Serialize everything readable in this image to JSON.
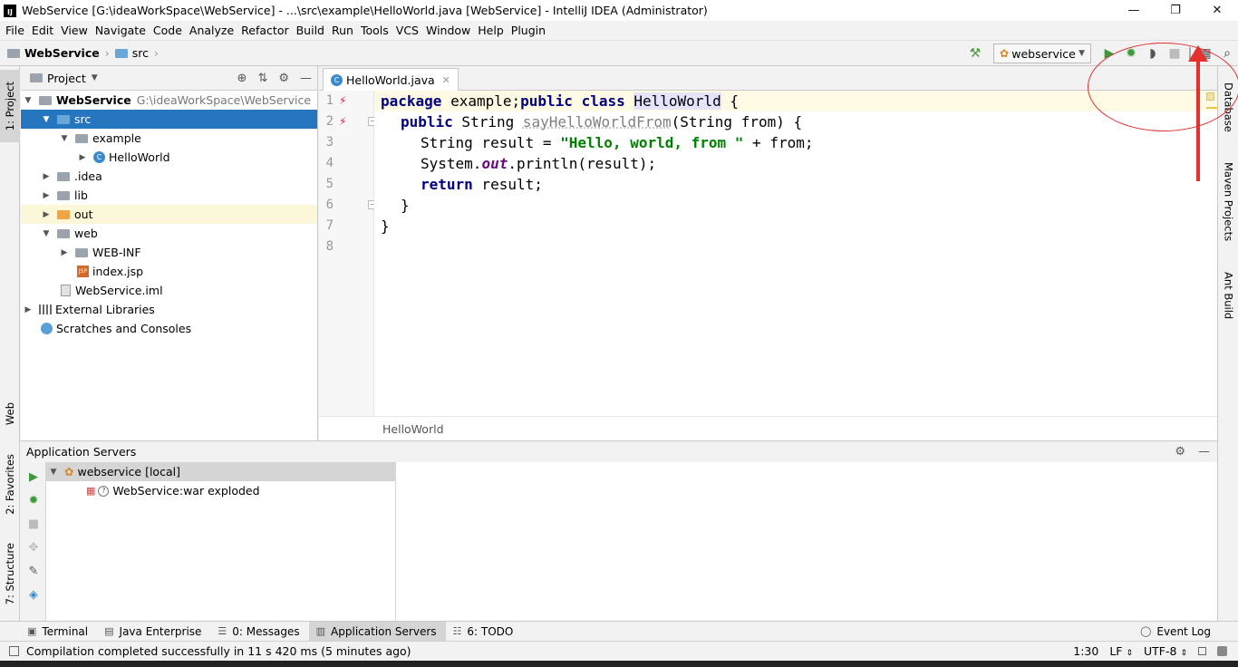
{
  "window": {
    "title": "WebService [G:\\ideaWorkSpace\\WebService] - ...\\src\\example\\HelloWorld.java [WebService] - IntelliJ IDEA (Administrator)",
    "app_icon_text": "IJ"
  },
  "menu": [
    "File",
    "Edit",
    "View",
    "Navigate",
    "Code",
    "Analyze",
    "Refactor",
    "Build",
    "Run",
    "Tools",
    "VCS",
    "Window",
    "Help",
    "Plugin"
  ],
  "breadcrumb": {
    "project": "WebService",
    "folder": "src"
  },
  "toolbar": {
    "run_config": "webservice"
  },
  "left_strip": {
    "project": "1: Project",
    "web": "Web",
    "favorites": "2: Favorites",
    "structure": "7: Structure"
  },
  "right_strip": {
    "database": "Database",
    "maven": "Maven Projects",
    "ant": "Ant Build"
  },
  "project_panel": {
    "title": "Project",
    "tree": [
      {
        "label": "WebService",
        "path": "G:\\ideaWorkSpace\\WebService"
      },
      {
        "label": "src"
      },
      {
        "label": "example"
      },
      {
        "label": "HelloWorld"
      },
      {
        "label": ".idea"
      },
      {
        "label": "lib"
      },
      {
        "label": "out"
      },
      {
        "label": "web"
      },
      {
        "label": "WEB-INF"
      },
      {
        "label": "index.jsp"
      },
      {
        "label": "WebService.iml"
      },
      {
        "label": "External Libraries"
      },
      {
        "label": "Scratches and Consoles"
      }
    ]
  },
  "editor": {
    "tab": "HelloWorld.java",
    "line_numbers": [
      "1",
      "2",
      "3",
      "4",
      "5",
      "6",
      "7",
      "8"
    ],
    "code": {
      "l1_kw1": "package",
      "l1_pkg": " example;",
      "l1_kw2": "public class",
      "l1_sp": " ",
      "l1_name": "HelloWorld",
      "l1_end": " {",
      "l2_kw": "public",
      "l2_type": " String ",
      "l2_method": "sayHelloWorldFrom",
      "l2_params": "(String from) {",
      "l3_a": "String result = ",
      "l3_str": "\"Hello, world, from \"",
      "l3_b": " + from;",
      "l4_a": "System.",
      "l4_out": "out",
      "l4_b": ".println(result);",
      "l5_kw": "return",
      "l5_b": " result;",
      "l6": "}",
      "l7": "}"
    },
    "breadcrumb": "HelloWorld"
  },
  "app_servers": {
    "title": "Application Servers",
    "server": "webservice [local]",
    "artifact": "WebService:war exploded"
  },
  "bottom_tabs": {
    "terminal": "Terminal",
    "java_enterprise": "Java Enterprise",
    "messages": "0: Messages",
    "app_servers": "Application Servers",
    "todo": "6: TODO",
    "event_log": "Event Log"
  },
  "status": {
    "message": "Compilation completed successfully in 11 s 420 ms (5 minutes ago)",
    "position": "1:30",
    "line_sep": "LF",
    "encoding": "UTF-8"
  },
  "colors": {
    "selection": "#2675bf",
    "keyword": "#000080",
    "string": "#008000",
    "annotation": "#e53030"
  }
}
